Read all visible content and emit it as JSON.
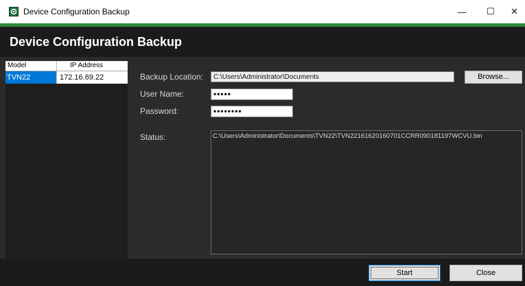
{
  "window": {
    "title": "Device Configuration Backup",
    "minimize_glyph": "—",
    "maximize_glyph": "☐",
    "close_glyph": "✕",
    "accent_color": "#2f8a3c"
  },
  "header": {
    "title": "Device Configuration Backup"
  },
  "device_list": {
    "columns": [
      "Model",
      "IP Address"
    ],
    "rows": [
      {
        "model": "TVN22",
        "ip": "172.16.69.22",
        "selected": true
      }
    ]
  },
  "form": {
    "backup_location_label": "Backup Location:",
    "backup_location_value": "C:\\Users\\Administrator\\Documents",
    "browse_label": "Browse...",
    "username_label": "User Name:",
    "username_value": "•••••",
    "password_label": "Password:",
    "password_value": "••••••••",
    "status_label": "Status:",
    "status_text": "C:\\Users\\Administrator\\Documents\\TVN22\\TVN22161620160701CCRR090181197WCVU.bin"
  },
  "footer": {
    "start_label": "Start",
    "close_label": "Close"
  }
}
